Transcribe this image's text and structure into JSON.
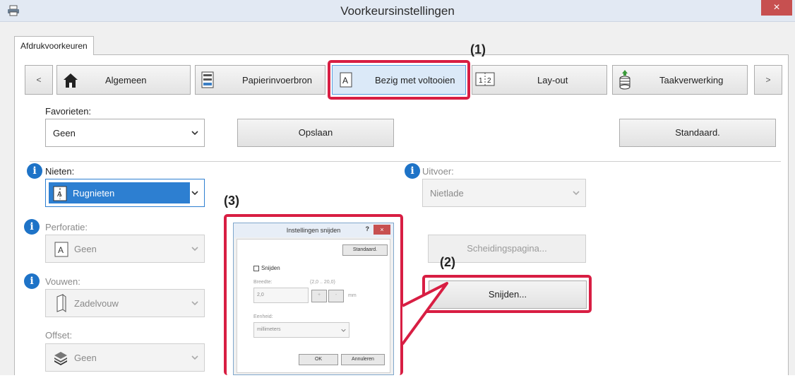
{
  "window": {
    "title": "Voorkeursinstellingen",
    "close_label": "×"
  },
  "tab": {
    "label": "Afdrukvoorkeuren"
  },
  "nav": {
    "prev": "<",
    "next": ">",
    "items": [
      {
        "label": "Algemeen",
        "icon": "home-icon"
      },
      {
        "label": "Papierinvoerbron",
        "icon": "paper-tray-icon"
      },
      {
        "label": "Bezig met voltooien",
        "icon": "finishing-icon"
      },
      {
        "label": "Lay-out",
        "icon": "layout-icon"
      },
      {
        "label": "Taakverwerking",
        "icon": "job-stack-icon"
      }
    ]
  },
  "favorites": {
    "label": "Favorieten:",
    "value": "Geen",
    "save": "Opslaan",
    "default": "Standaard."
  },
  "stapling": {
    "label": "Nieten:",
    "value": "Rugnieten"
  },
  "output": {
    "label": "Uitvoer:",
    "value": "Nietlade"
  },
  "punch": {
    "label": "Perforatie:",
    "value": "Geen"
  },
  "separator_button": "Scheidingspagina...",
  "trim_button": "Snijden...",
  "fold": {
    "label": "Vouwen:",
    "value": "Zadelvouw"
  },
  "offset": {
    "label": "Offset:",
    "value": "Geen"
  },
  "callouts": {
    "c1": "(1)",
    "c2": "(2)",
    "c3": "(3)"
  },
  "trim_dialog": {
    "title": "Instellingen snijden",
    "help": "?",
    "close": "×",
    "default": "Standaard.",
    "checkbox": "Snijden",
    "width_label": "Breedte:",
    "range": "(2,0 .. 20,0)",
    "width_value": "2,0",
    "unit_suffix": "mm",
    "unit_label": "Eenheid:",
    "unit_value": "millimeters",
    "ok": "OK",
    "cancel": "Annuleren"
  },
  "colors": {
    "accent": "#d81e43",
    "info": "#1e73c7",
    "active": "#dbe9f8"
  }
}
